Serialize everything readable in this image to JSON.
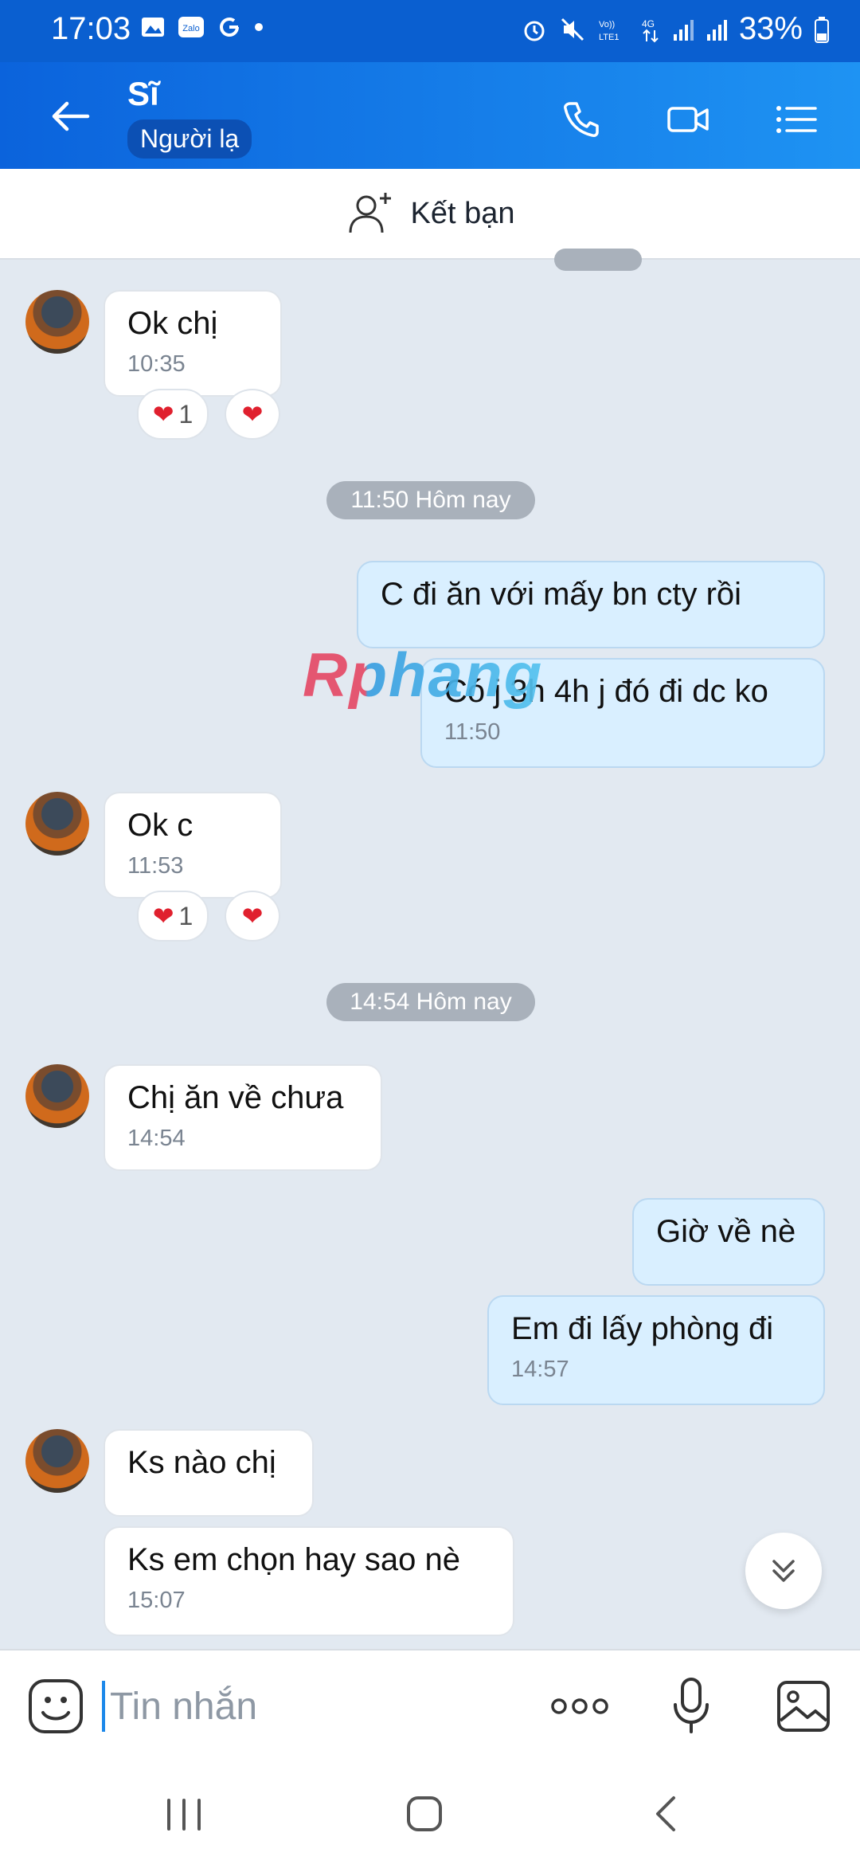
{
  "status_bar": {
    "time": "17:03",
    "battery": "33%"
  },
  "header": {
    "contact_name": "Sĩ",
    "badge": "Người lạ"
  },
  "add_friend": {
    "label": "Kết bạn"
  },
  "messages": [
    {
      "text": "Ok chị",
      "time": "10:35",
      "reaction_count": "1"
    },
    {
      "pill": "11:50 Hôm nay"
    },
    {
      "text": "C đi ăn với  mấy  bn  cty rồi"
    },
    {
      "text": "Có j 3h 4h j đó đi dc ko",
      "time": "11:50"
    },
    {
      "text": "Ok c",
      "time": "11:53",
      "reaction_count": "1"
    },
    {
      "pill": "14:54 Hôm nay"
    },
    {
      "text": "Chị ăn về chưa",
      "time": "14:54"
    },
    {
      "text": "Giờ về nè"
    },
    {
      "text": "Em đi lấy phòng đi",
      "time": "14:57"
    },
    {
      "text": "Ks nào chị"
    },
    {
      "text": "Ks em chọn hay sao nè",
      "time": "15:07"
    }
  ],
  "watermark": "Rphang",
  "composer": {
    "placeholder": "Tin nhắn"
  },
  "colors": {
    "brand_blue": "#0b63dc",
    "outgoing_bubble": "#d9efff"
  }
}
